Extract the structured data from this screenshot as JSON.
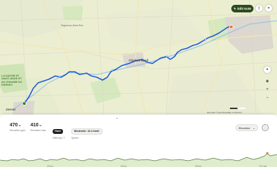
{
  "map": {
    "labels": {
      "segonzac": "Segonzac-Aires-Rou",
      "mid_town": "Chalais-Baril",
      "green_area": "LA SAVOIE ET SAINT-ANGE ET AU CHAUME DU DANSAC",
      "start_town": "Jarnac"
    },
    "edit_route": {
      "icon": "pencil-icon",
      "label": "Edit route"
    },
    "top_icons": {
      "bookmark": "bookmark-icon",
      "close": "close-icon"
    },
    "controls": {
      "compass": "compass-icon",
      "layers": "layers-icon",
      "locate": "locate-icon",
      "zoom_in": "+",
      "zoom_out": "−"
    },
    "attribution": "Map data © OpenStreetMap contributors",
    "colors": {
      "route": "#1d5bd6",
      "water": "#7fb6e6",
      "green_area": "#cfe4b4",
      "urban": "#d9d4cc"
    }
  },
  "sheet": {
    "grabber": "chevron-down-icon",
    "elevation_gain": {
      "value": "470",
      "unit": "m",
      "label": "Elevation gain"
    },
    "elevation_loss": {
      "value": "410",
      "unit": "m",
      "label": "Elevation loss"
    },
    "difficulty": {
      "value": "Hard",
      "label": "Difficulty ⓘ"
    },
    "speed": {
      "value": "Moderate: 13.4 km/h",
      "label": "Speed"
    },
    "profile_select": {
      "label": "Elevation",
      "icon": "chevron-down-icon"
    },
    "info_icon": "info-icon",
    "x_ticks": [
      "20 km",
      "40 km",
      "60 km",
      "75.1 km"
    ],
    "profile_color": "#4f7a3a"
  }
}
